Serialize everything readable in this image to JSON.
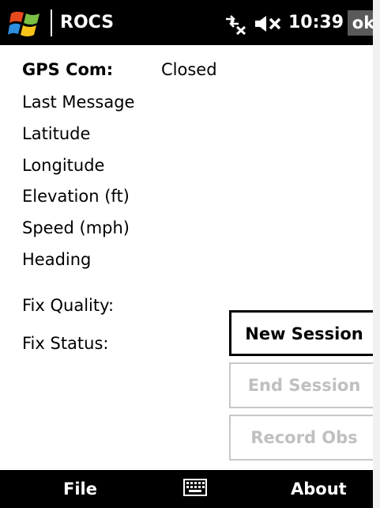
{
  "titlebar": {
    "app_title": "ROCS",
    "time": "10:39",
    "ok_label": "ok",
    "icons": {
      "start": "windows-flag-icon",
      "connectivity": "connection-off-icon",
      "volume": "volume-muted-icon"
    }
  },
  "fields": {
    "gps_com_label": "GPS Com:",
    "gps_com_value": "Closed",
    "last_message_label": "Last Message",
    "latitude_label": "Latitude",
    "longitude_label": "Longitude",
    "elevation_label": "Elevation (ft)",
    "speed_label": "Speed (mph)",
    "heading_label": "Heading",
    "fix_quality_label": "Fix Quality:",
    "fix_status_label": "Fix Status:"
  },
  "buttons": {
    "new_session": "New Session",
    "end_session": "End Session",
    "record_obs": "Record Obs"
  },
  "menubar": {
    "left": "File",
    "right": "About",
    "keyboard_icon": "keyboard-icon"
  },
  "colors": {
    "bar_background": "#000000",
    "ok_background": "#5a5a5a",
    "disabled_text": "#c0c0c0"
  }
}
